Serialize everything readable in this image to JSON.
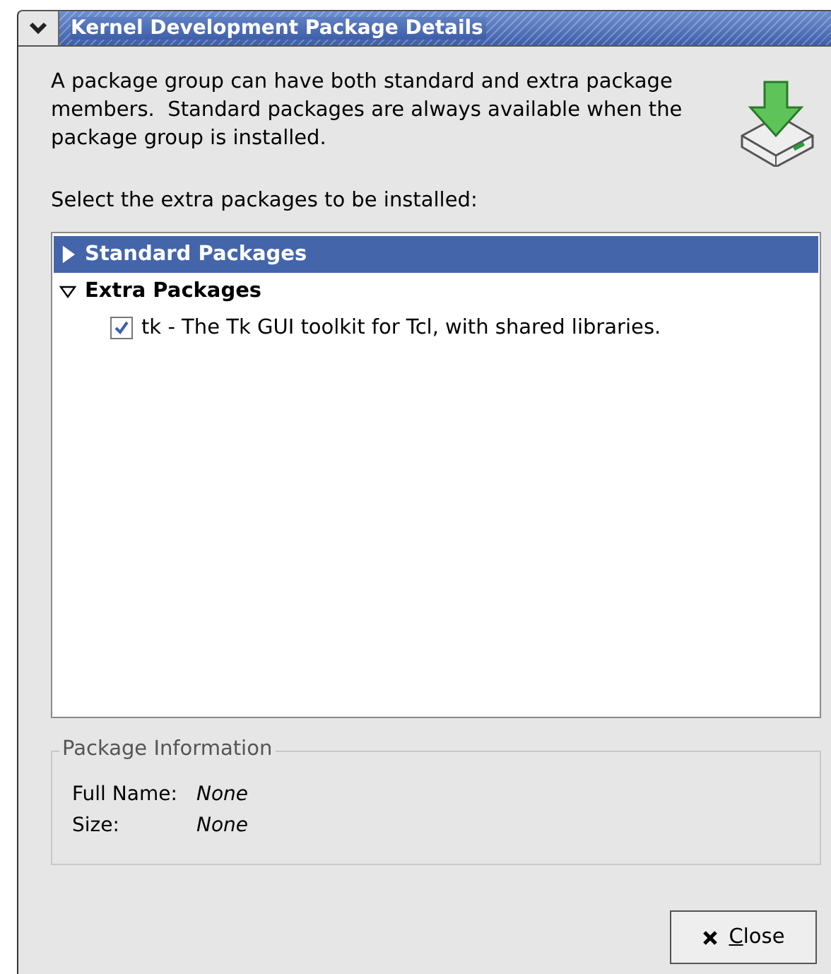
{
  "window": {
    "title": "Kernel Development Package Details"
  },
  "description": "A package group can have both standard and extra package members.  Standard packages are always available when the package group is installed.",
  "prompt": "Select the extra packages to be installed:",
  "tree": [
    {
      "label": "Standard Packages",
      "expanded": false,
      "selected": true
    },
    {
      "label": "Extra Packages",
      "expanded": true,
      "selected": false,
      "children": [
        {
          "label": "tk - The Tk GUI toolkit for Tcl, with shared libraries.",
          "checked": true
        }
      ]
    }
  ],
  "package_information": {
    "title": "Package Information",
    "fields": [
      {
        "label": "Full Name:",
        "value": "None"
      },
      {
        "label": "Size:",
        "value": "None"
      }
    ]
  },
  "buttons": [
    {
      "label": "Close"
    }
  ]
}
